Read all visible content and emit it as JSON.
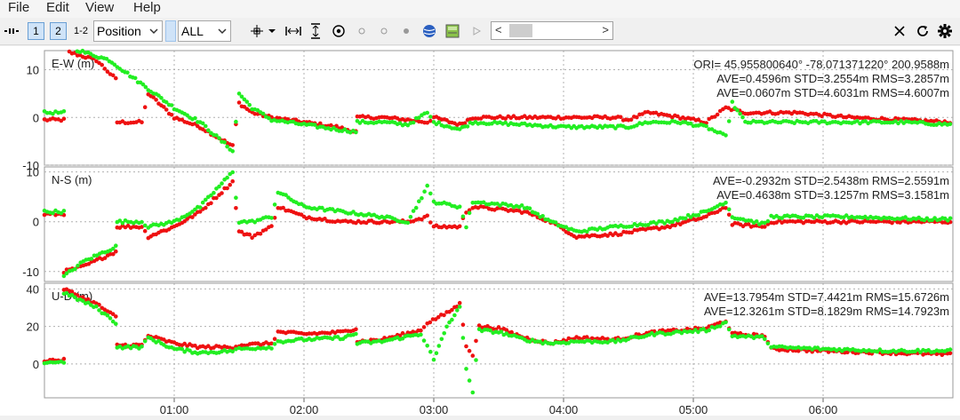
{
  "menu": {
    "file": "File",
    "edit": "Edit",
    "view": "View",
    "help": "Help"
  },
  "toolbar": {
    "plot_buttons": [
      "1",
      "2",
      "1-2"
    ],
    "plot_type": "Position",
    "quality": "ALL",
    "slider_left": "<",
    "slider_right": ">"
  },
  "icons": [
    "mark-icon",
    "dropdown-icon",
    "fit-horizontal-icon",
    "fit-vertical-icon",
    "center-origin-icon",
    "circle-icon",
    "circle-icon",
    "dot-icon",
    "globe-icon",
    "map-icon",
    "play-icon",
    "close-icon",
    "reload-icon",
    "settings-icon"
  ],
  "colors": {
    "series_1": "#ee1111",
    "series_2": "#22ee22",
    "grid": "#b0b0b0"
  },
  "chart_data": {
    "type": "scatter",
    "x_ticks": [
      "01:00",
      "02:00",
      "03:00",
      "04:00",
      "05:00",
      "06:00"
    ],
    "panels": [
      {
        "label": "E-W (m)",
        "ylim": [
          -10,
          14
        ],
        "yticks": [
          "10",
          "0",
          "-10"
        ],
        "origin": "ORI= 45.955800640°  -78.071371220°  200.9588m",
        "stats": [
          "AVE=0.4596m STD=3.2554m RMS=3.2857m",
          "AVE=0.0607m STD=4.6031m RMS=4.6007m"
        ],
        "series": [
          {
            "color": "red",
            "points": [
              [
                0.0,
                -0.5
              ],
              [
                0.15,
                -0.5
              ],
              [
                0.15,
                14
              ],
              [
                0.4,
                12
              ],
              [
                0.55,
                8
              ],
              [
                0.56,
                -1
              ],
              [
                0.75,
                -1
              ],
              [
                0.8,
                5
              ],
              [
                1.0,
                0
              ],
              [
                1.2,
                -2
              ],
              [
                1.45,
                -6
              ],
              [
                1.5,
                3
              ],
              [
                1.6,
                1
              ],
              [
                1.75,
                0
              ],
              [
                2.0,
                -1
              ],
              [
                2.25,
                -2
              ],
              [
                2.4,
                -3
              ],
              [
                2.41,
                0
              ],
              [
                2.6,
                0
              ],
              [
                2.8,
                -0.5
              ],
              [
                2.95,
                -1
              ],
              [
                3.0,
                0
              ],
              [
                3.2,
                -1.5
              ],
              [
                3.3,
                0
              ],
              [
                3.7,
                0
              ],
              [
                4.0,
                0
              ],
              [
                4.2,
                0
              ],
              [
                4.4,
                0
              ],
              [
                4.5,
                -0.5
              ],
              [
                4.65,
                1
              ],
              [
                4.9,
                0
              ],
              [
                5.1,
                -1
              ],
              [
                5.25,
                2
              ],
              [
                5.4,
                1
              ],
              [
                5.8,
                1
              ],
              [
                6.2,
                0
              ],
              [
                6.6,
                -0.5
              ],
              [
                7.0,
                -1
              ]
            ]
          },
          {
            "color": "green",
            "points": [
              [
                0.0,
                1
              ],
              [
                0.15,
                1
              ],
              [
                0.15,
                15
              ],
              [
                0.5,
                12
              ],
              [
                0.6,
                10
              ],
              [
                0.8,
                6
              ],
              [
                1.0,
                2
              ],
              [
                1.2,
                -1
              ],
              [
                1.45,
                -7
              ],
              [
                1.5,
                5
              ],
              [
                1.6,
                2
              ],
              [
                1.75,
                -0.5
              ],
              [
                2.0,
                -1.5
              ],
              [
                2.25,
                -2.5
              ],
              [
                2.4,
                -3
              ],
              [
                2.41,
                -1
              ],
              [
                2.6,
                -1
              ],
              [
                2.8,
                -1.5
              ],
              [
                2.95,
                1
              ],
              [
                3.0,
                -1
              ],
              [
                3.2,
                -2.5
              ],
              [
                3.3,
                -1
              ],
              [
                3.7,
                -1.5
              ],
              [
                4.0,
                -2
              ],
              [
                4.2,
                -2
              ],
              [
                4.4,
                -2
              ],
              [
                4.5,
                -2
              ],
              [
                4.65,
                -1
              ],
              [
                4.9,
                -1
              ],
              [
                5.1,
                -2
              ],
              [
                5.25,
                -4
              ],
              [
                5.3,
                3
              ],
              [
                5.4,
                -1
              ],
              [
                5.8,
                -1
              ],
              [
                6.2,
                -1
              ],
              [
                6.6,
                -1
              ],
              [
                7.0,
                -1.5
              ]
            ]
          }
        ]
      },
      {
        "label": "N-S (m)",
        "ylim": [
          -12,
          11
        ],
        "yticks": [
          "10",
          "0",
          "-10"
        ],
        "stats": [
          "AVE=-0.2932m STD=2.5438m RMS=2.5591m",
          "AVE=0.4638m STD=3.1257m RMS=3.1581m"
        ],
        "series": [
          {
            "color": "red",
            "points": [
              [
                0.0,
                1.5
              ],
              [
                0.15,
                1.5
              ],
              [
                0.15,
                -10
              ],
              [
                0.3,
                -9
              ],
              [
                0.55,
                -6
              ],
              [
                0.56,
                -1
              ],
              [
                0.75,
                -1
              ],
              [
                0.8,
                -3
              ],
              [
                1.0,
                -1
              ],
              [
                1.2,
                2
              ],
              [
                1.45,
                8
              ],
              [
                1.5,
                -2
              ],
              [
                1.6,
                -3
              ],
              [
                1.75,
                -1
              ],
              [
                1.8,
                3
              ],
              [
                2.0,
                1
              ],
              [
                2.3,
                0
              ],
              [
                2.6,
                0
              ],
              [
                2.8,
                0
              ],
              [
                2.95,
                1
              ],
              [
                3.0,
                -1
              ],
              [
                3.2,
                -1
              ],
              [
                3.25,
                2
              ],
              [
                3.3,
                3
              ],
              [
                3.7,
                2
              ],
              [
                3.9,
                0
              ],
              [
                4.1,
                -3
              ],
              [
                4.4,
                -2.5
              ],
              [
                4.8,
                -1
              ],
              [
                5.1,
                1
              ],
              [
                5.25,
                3
              ],
              [
                5.3,
                -0.5
              ],
              [
                5.55,
                -1
              ],
              [
                5.6,
                0
              ],
              [
                6.2,
                0
              ],
              [
                6.8,
                0
              ],
              [
                7.0,
                0
              ]
            ]
          },
          {
            "color": "green",
            "points": [
              [
                0.0,
                2
              ],
              [
                0.15,
                2
              ],
              [
                0.15,
                -11
              ],
              [
                0.3,
                -8
              ],
              [
                0.55,
                -5
              ],
              [
                0.56,
                0
              ],
              [
                0.75,
                0
              ],
              [
                0.8,
                -1
              ],
              [
                1.0,
                0
              ],
              [
                1.2,
                3
              ],
              [
                1.45,
                10
              ],
              [
                1.5,
                0
              ],
              [
                1.6,
                0
              ],
              [
                1.75,
                1
              ],
              [
                1.8,
                6
              ],
              [
                2.0,
                3
              ],
              [
                2.3,
                2
              ],
              [
                2.6,
                1
              ],
              [
                2.8,
                0
              ],
              [
                2.95,
                7
              ],
              [
                3.0,
                4
              ],
              [
                3.2,
                3
              ],
              [
                3.25,
                -1
              ],
              [
                3.3,
                4
              ],
              [
                3.7,
                3
              ],
              [
                3.9,
                0
              ],
              [
                4.1,
                -2
              ],
              [
                4.4,
                -1
              ],
              [
                4.8,
                0
              ],
              [
                5.1,
                2
              ],
              [
                5.25,
                4
              ],
              [
                5.3,
                1
              ],
              [
                5.55,
                -0.5
              ],
              [
                5.6,
                1
              ],
              [
                6.2,
                1
              ],
              [
                6.8,
                0.5
              ],
              [
                7.0,
                0.5
              ]
            ]
          }
        ]
      },
      {
        "label": "U-D (m)",
        "ylim": [
          -18,
          43
        ],
        "yticks": [
          "40",
          "20",
          "0"
        ],
        "stats": [
          "AVE=13.7954m STD=7.4421m RMS=15.6726m",
          "AVE=12.3261m STD=8.1829m RMS=14.7923m"
        ],
        "series": [
          {
            "color": "red",
            "points": [
              [
                0.0,
                2
              ],
              [
                0.15,
                2
              ],
              [
                0.15,
                40
              ],
              [
                0.4,
                32
              ],
              [
                0.55,
                25
              ],
              [
                0.56,
                10
              ],
              [
                0.75,
                10
              ],
              [
                0.8,
                15
              ],
              [
                1.0,
                11
              ],
              [
                1.2,
                9
              ],
              [
                1.45,
                9
              ],
              [
                1.5,
                10
              ],
              [
                1.75,
                11
              ],
              [
                1.8,
                17
              ],
              [
                2.0,
                16
              ],
              [
                2.3,
                17
              ],
              [
                2.4,
                19
              ],
              [
                2.41,
                12
              ],
              [
                2.6,
                13
              ],
              [
                2.9,
                18
              ],
              [
                2.95,
                22
              ],
              [
                3.1,
                27
              ],
              [
                3.2,
                32
              ],
              [
                3.25,
                10
              ],
              [
                3.3,
                5
              ],
              [
                3.35,
                20
              ],
              [
                3.5,
                19
              ],
              [
                3.7,
                14
              ],
              [
                3.9,
                11
              ],
              [
                4.1,
                14
              ],
              [
                4.4,
                13
              ],
              [
                4.7,
                17
              ],
              [
                5.1,
                19
              ],
              [
                5.25,
                23
              ],
              [
                5.3,
                16
              ],
              [
                5.55,
                15
              ],
              [
                5.6,
                8
              ],
              [
                6.0,
                7
              ],
              [
                6.5,
                6
              ],
              [
                7.0,
                5
              ]
            ]
          },
          {
            "color": "green",
            "points": [
              [
                0.0,
                1
              ],
              [
                0.15,
                1
              ],
              [
                0.15,
                38
              ],
              [
                0.4,
                30
              ],
              [
                0.55,
                22
              ],
              [
                0.56,
                9
              ],
              [
                0.75,
                9
              ],
              [
                0.8,
                14
              ],
              [
                1.0,
                8
              ],
              [
                1.2,
                6
              ],
              [
                1.45,
                7
              ],
              [
                1.5,
                8
              ],
              [
                1.75,
                9
              ],
              [
                1.8,
                12
              ],
              [
                2.0,
                13
              ],
              [
                2.3,
                14
              ],
              [
                2.4,
                16
              ],
              [
                2.41,
                11
              ],
              [
                2.6,
                12
              ],
              [
                2.9,
                16
              ],
              [
                2.95,
                10
              ],
              [
                3.0,
                2
              ],
              [
                3.1,
                20
              ],
              [
                3.2,
                30
              ],
              [
                3.25,
                -2
              ],
              [
                3.3,
                -15
              ],
              [
                3.35,
                18
              ],
              [
                3.5,
                17
              ],
              [
                3.7,
                13
              ],
              [
                3.9,
                11
              ],
              [
                4.1,
                12
              ],
              [
                4.4,
                12
              ],
              [
                4.7,
                16
              ],
              [
                5.1,
                18
              ],
              [
                5.25,
                22
              ],
              [
                5.3,
                15
              ],
              [
                5.55,
                14
              ],
              [
                5.6,
                9
              ],
              [
                6.0,
                8
              ],
              [
                6.5,
                7
              ],
              [
                7.0,
                7
              ]
            ]
          }
        ]
      }
    ]
  }
}
